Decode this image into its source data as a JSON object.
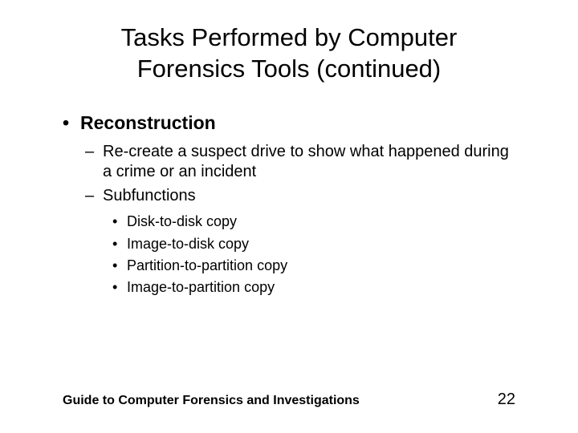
{
  "title_line1": "Tasks Performed by Computer",
  "title_line2": "Forensics Tools (continued)",
  "bullets": {
    "l1_0": "Reconstruction",
    "l2_0": "Re-create a suspect drive to show what happened during a crime or an incident",
    "l2_1": "Subfunctions",
    "l3_0": "Disk-to-disk copy",
    "l3_1": "Image-to-disk copy",
    "l3_2": "Partition-to-partition copy",
    "l3_3": "Image-to-partition copy"
  },
  "footer": {
    "text": "Guide to Computer Forensics and Investigations",
    "page": "22"
  }
}
